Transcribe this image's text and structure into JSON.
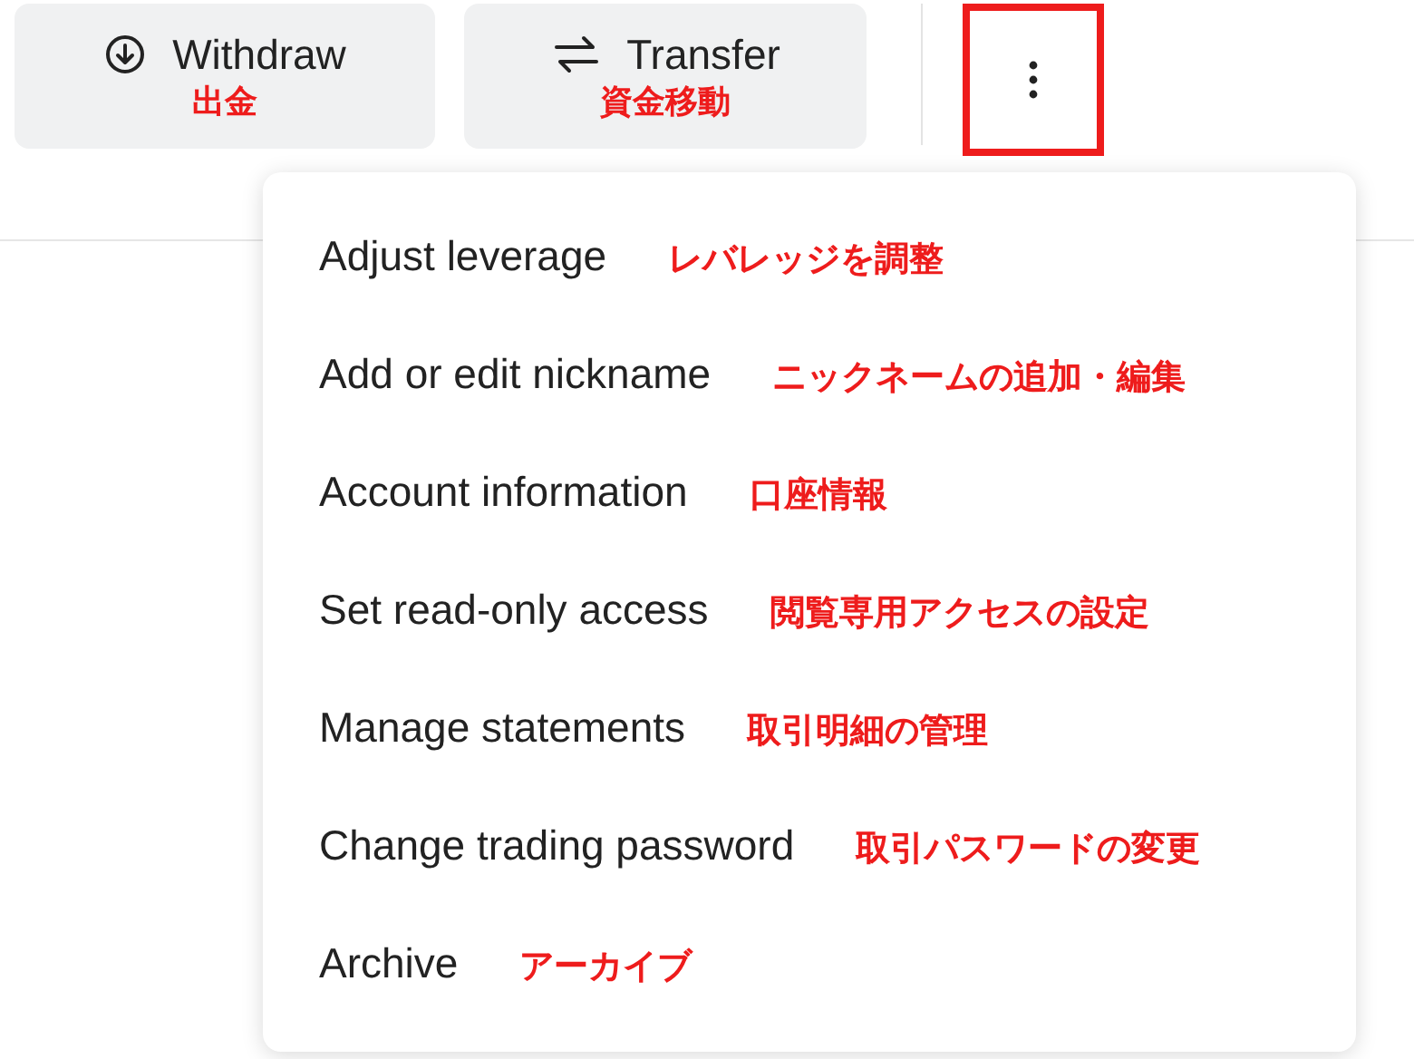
{
  "actions": [
    {
      "kind": "withdraw",
      "label": "Withdraw",
      "note": "出金"
    },
    {
      "kind": "transfer",
      "label": "Transfer",
      "note": "資金移動"
    }
  ],
  "more_button": {
    "highlighted": true
  },
  "menu": [
    {
      "label": "Adjust leverage",
      "note": "レバレッジを調整"
    },
    {
      "label": "Add or edit nickname",
      "note": "ニックネームの追加・編集"
    },
    {
      "label": "Account information",
      "note": "口座情報"
    },
    {
      "label": "Set read-only access",
      "note": "閲覧専用アクセスの設定"
    },
    {
      "label": "Manage statements",
      "note": "取引明細の管理"
    },
    {
      "label": "Change trading password",
      "note": "取引パスワードの変更"
    },
    {
      "label": "Archive",
      "note": "アーカイブ"
    }
  ]
}
